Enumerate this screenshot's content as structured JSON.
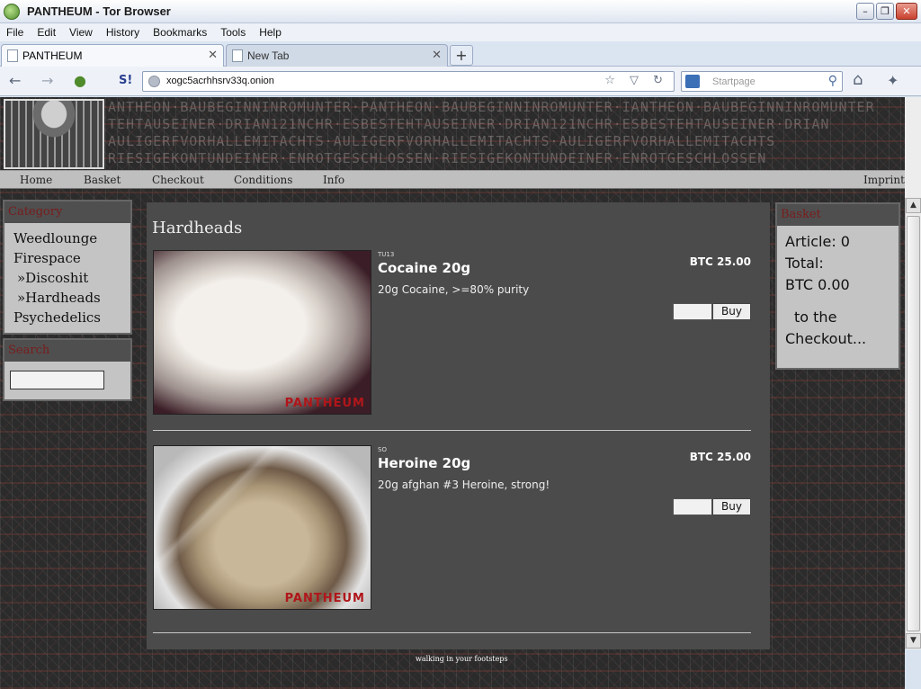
{
  "window": {
    "title": "PANTHEUM - Tor Browser",
    "min": "–",
    "max": "❐",
    "close": "✕"
  },
  "menu": [
    "File",
    "Edit",
    "View",
    "History",
    "Bookmarks",
    "Tools",
    "Help"
  ],
  "tabs": [
    {
      "label": "PANTHEUM",
      "close": "✕"
    },
    {
      "label": "New Tab",
      "close": "✕"
    }
  ],
  "new_tab": "+",
  "toolbar": {
    "back": "←",
    "forward": "→",
    "onion": "●",
    "noscript": "S!",
    "url": "xogc5acrhhsrv33q.onion",
    "url_tools": "☆ ▽ ↻",
    "search_placeholder": "Startpage",
    "search_icon": "⚲",
    "home": "⌂",
    "addon": "✦"
  },
  "header_pattern": "ANTHEON·BAUBEGINNINROMUNTER·PANTHEON·BAUBEGINNINROMUNTER·IANTHEON·BAUBEGINNINROMUNTER",
  "header_pattern2": "TEHTAUSEINER·DRIAN121NCHR·ESBESTEHTAUSEINER·DRIAN121NCHR·ESBESTEHTAUSEINER·DRIAN",
  "header_pattern3": "AULIGERFVORHALLEMITACHTS·AULIGERFVORHALLEMITACHTS·AULIGERFVORHALLEMITACHTS",
  "header_pattern4": "RIESIGEKONTUNDEINER·ENROTGESCHLOSSEN·RIESIGEKONTUNDEINER·ENROTGESCHLOSSEN",
  "nav": {
    "home": "Home",
    "basket": "Basket",
    "checkout": "Checkout",
    "conditions": "Conditions",
    "info": "Info",
    "imprint": "Imprint"
  },
  "category": {
    "title": "Category",
    "items": [
      "Weedlounge",
      "Firespace",
      "»Discoshit",
      "»Hardheads",
      "Psychedelics"
    ]
  },
  "search": {
    "title": "Search"
  },
  "main": {
    "title": "Hardheads",
    "products": [
      {
        "code": "TU13",
        "name": "Cocaine 20g",
        "desc": "20g Cocaine, >=80% purity",
        "price": "BTC 25.00",
        "buy": "Buy",
        "watermark": "PANTHEUM"
      },
      {
        "code": "SO",
        "name": "Heroine 20g",
        "desc": "20g afghan #3 Heroine, strong!",
        "price": "BTC 25.00",
        "buy": "Buy",
        "watermark": "PANTHEUM"
      }
    ]
  },
  "basket": {
    "title": "Basket",
    "article": "Article: 0",
    "total_label": "Total:",
    "total_value": "BTC 0.00",
    "checkout_1": "to the",
    "checkout_2": "Checkout..."
  },
  "footer": "walking in your footsteps",
  "scroll": {
    "up": "▲",
    "down": "▼"
  }
}
